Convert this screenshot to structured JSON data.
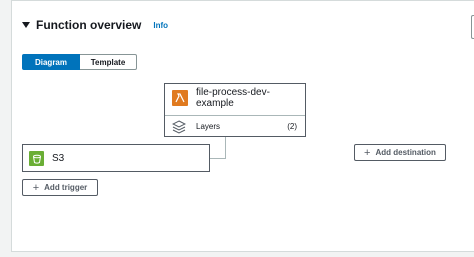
{
  "section": {
    "title": "Function overview",
    "info_link": "Info"
  },
  "view_toggle": {
    "options": [
      "Diagram",
      "Template"
    ],
    "selected": "Diagram"
  },
  "function_node": {
    "name": "file-process-dev-example",
    "icon": "lambda-icon",
    "layers_label": "Layers",
    "layers_count": "(2)"
  },
  "trigger_node": {
    "label": "S3",
    "icon": "s3-bucket-icon"
  },
  "buttons": {
    "add_trigger": "Add trigger",
    "add_destination": "Add destination"
  },
  "colors": {
    "accent": "#0073bb",
    "lambda": "#e07a1f",
    "s3": "#6aae35"
  }
}
